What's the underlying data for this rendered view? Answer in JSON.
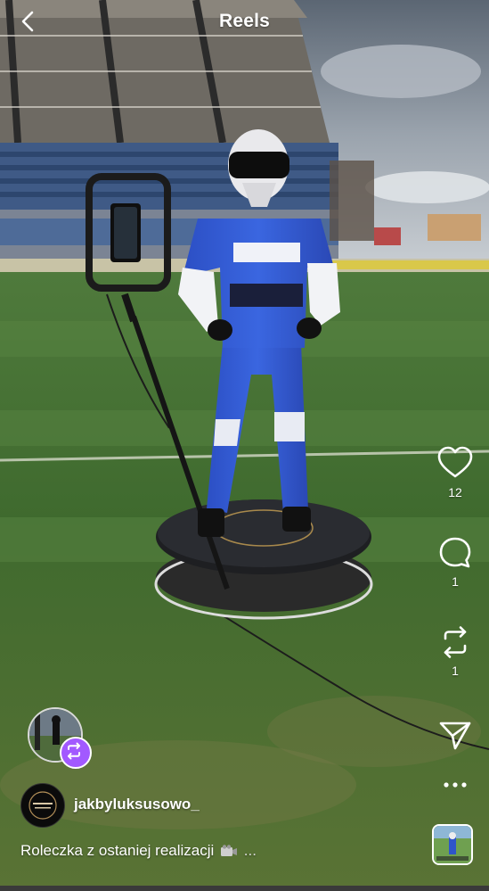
{
  "header": {
    "title": "Reels",
    "back_icon": "chevron-left-icon"
  },
  "actions": {
    "like": {
      "icon": "heart-icon",
      "count": "12"
    },
    "comment": {
      "icon": "comment-icon",
      "count": "1"
    },
    "repost": {
      "icon": "repost-icon",
      "count": "1"
    },
    "share": {
      "icon": "paper-plane-icon"
    },
    "more": {
      "icon": "more-horizontal-icon"
    }
  },
  "author": {
    "username": "jakbyluksusowo_",
    "caption_text": "Roleczka z ostaniej realizacji",
    "caption_more": "..."
  },
  "colors": {
    "accent_repost": "#a259ff",
    "text": "#ffffff"
  }
}
